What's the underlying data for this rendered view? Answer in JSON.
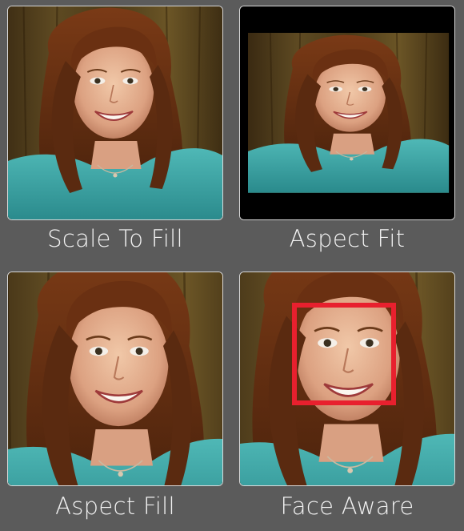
{
  "panels": [
    {
      "caption": "Scale To Fill"
    },
    {
      "caption": "Aspect Fit"
    },
    {
      "caption": "Aspect Fill"
    },
    {
      "caption": "Face Aware"
    }
  ],
  "colors": {
    "background": "#5b5b5b",
    "frame_border": "#d8d8d8",
    "caption_text": "#f2f2f2",
    "face_highlight": "#e8202e",
    "letterbox": "#000000"
  }
}
